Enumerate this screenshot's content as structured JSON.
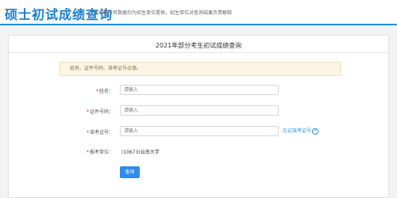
{
  "header": {
    "title": "硕士初试成绩查询",
    "description": "本系统所有数据均为招生单位提供，招生单位对查询结果负责解释",
    "accent_color": "#1f90e8"
  },
  "card": {
    "title": "2021年部分考生初试成绩查询",
    "notice": "姓名、证件号码、准考证号必填。"
  },
  "form": {
    "required_mark": "*",
    "name": {
      "label": "姓名：",
      "placeholder": "请输入"
    },
    "id_number": {
      "label": "证件号码：",
      "placeholder": "请输入"
    },
    "exam_number": {
      "label": "准考证号：",
      "placeholder": "请输入",
      "forgot_link": "忘记准考证号",
      "help_icon": "?"
    },
    "unit": {
      "label": "报考单位：",
      "value": "(10673)云南大学"
    },
    "submit_label": "查询",
    "button_color": "#2d8cf0"
  }
}
